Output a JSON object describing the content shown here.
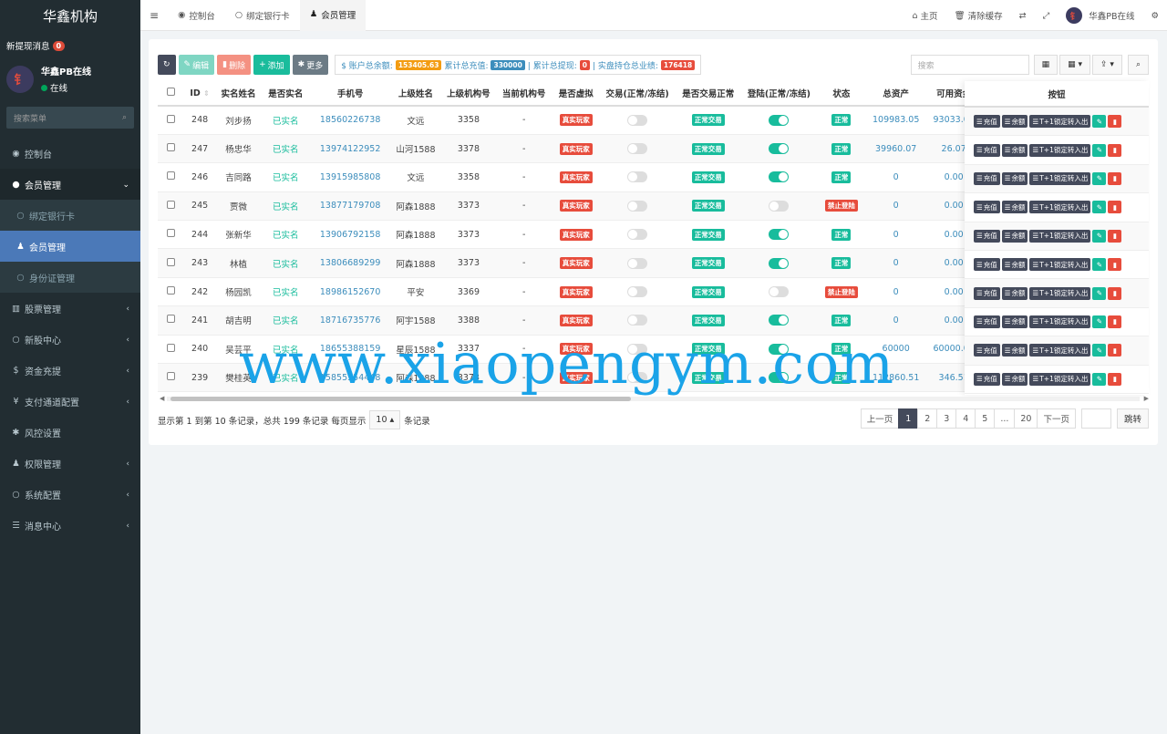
{
  "sidebar": {
    "brand": "华鑫机构",
    "notice_label": "新提现消息",
    "notice_count": "0",
    "user_avatar_char": "钅",
    "user_name": "华鑫PB在线",
    "user_status": "在线",
    "search_placeholder": "搜索菜单",
    "items": [
      {
        "icon": "dashboard-icon",
        "glyph": "◉",
        "label": "控制台"
      },
      {
        "icon": "user-circle-icon",
        "glyph": "●",
        "label": "会员管理"
      },
      {
        "icon": "circle-icon",
        "glyph": "○",
        "label": "绑定银行卡"
      },
      {
        "icon": "user-icon",
        "glyph": "♟",
        "label": "会员管理"
      },
      {
        "icon": "circle-icon",
        "glyph": "○",
        "label": "身份证管理"
      },
      {
        "icon": "bank-icon",
        "glyph": "▥",
        "label": "股票管理"
      },
      {
        "icon": "circle-icon",
        "glyph": "○",
        "label": "新股中心"
      },
      {
        "icon": "dollar-icon",
        "glyph": "$",
        "label": "资金充提"
      },
      {
        "icon": "yen-icon",
        "glyph": "¥",
        "label": "支付通道配置"
      },
      {
        "icon": "gear-icon",
        "glyph": "✱",
        "label": "风控设置"
      },
      {
        "icon": "users-icon",
        "glyph": "♟",
        "label": "权限管理"
      },
      {
        "icon": "circle-icon",
        "glyph": "○",
        "label": "系统配置"
      },
      {
        "icon": "list-icon",
        "glyph": "☰",
        "label": "消息中心"
      }
    ]
  },
  "topbar": {
    "tabs": [
      {
        "icon": "dashboard-icon",
        "glyph": "◉",
        "label": "控制台"
      },
      {
        "icon": "circle-icon",
        "glyph": "○",
        "label": "绑定银行卡"
      },
      {
        "icon": "user-icon",
        "glyph": "♟",
        "label": "会员管理"
      }
    ],
    "home_label": "主页",
    "clear_cache_label": "清除缓存",
    "user_name": "华鑫PB在线"
  },
  "toolbar": {
    "refresh": "↻",
    "edit": "编辑",
    "delete": "删除",
    "add": "添加",
    "more": "更多",
    "summary_balance_label": "$ 账户总余额:",
    "summary_balance": "153405.63",
    "summary_recharge_label": "累计总充值:",
    "summary_recharge": "330000",
    "summary_withdraw_label": "| 累计总提现:",
    "summary_withdraw": "0",
    "summary_hold_label": "| 实盘持仓总业绩:",
    "summary_hold": "176418",
    "search_placeholder": "搜索"
  },
  "table": {
    "headers": [
      "ID",
      "实名姓名",
      "是否实名",
      "手机号",
      "上级姓名",
      "上级机构号",
      "当前机构号",
      "是否虚拟",
      "交易(正常/冻结)",
      "是否交易正常",
      "登陆(正常/冻结)",
      "状态",
      "总资产",
      "可用资金"
    ],
    "action_header": "按钮",
    "rows": [
      {
        "id": "248",
        "name": "刘步扬",
        "real": "已实名",
        "phone": "18560226738",
        "parent": "文远",
        "parent_org": "3358",
        "org": "-",
        "virtual": "真实玩家",
        "trade": "off",
        "trade_ok": "正常交易",
        "login": "on",
        "status": "正常",
        "status_c": "green",
        "assets": "109983.05",
        "avail": "93033.05"
      },
      {
        "id": "247",
        "name": "杨忠华",
        "real": "已实名",
        "phone": "13974122952",
        "parent": "山河1588",
        "parent_org": "3378",
        "org": "-",
        "virtual": "真实玩家",
        "trade": "off",
        "trade_ok": "正常交易",
        "login": "on",
        "status": "正常",
        "status_c": "green",
        "assets": "39960.07",
        "avail": "26.07"
      },
      {
        "id": "246",
        "name": "吉同路",
        "real": "已实名",
        "phone": "13915985808",
        "parent": "文远",
        "parent_org": "3358",
        "org": "-",
        "virtual": "真实玩家",
        "trade": "off",
        "trade_ok": "正常交易",
        "login": "on",
        "status": "正常",
        "status_c": "green",
        "assets": "0",
        "avail": "0.00"
      },
      {
        "id": "245",
        "name": "贾微",
        "real": "已实名",
        "phone": "13877179708",
        "parent": "阿森1888",
        "parent_org": "3373",
        "org": "-",
        "virtual": "真实玩家",
        "trade": "off",
        "trade_ok": "正常交易",
        "login": "off",
        "status": "禁止登陆",
        "status_c": "red",
        "assets": "0",
        "avail": "0.00"
      },
      {
        "id": "244",
        "name": "张新华",
        "real": "已实名",
        "phone": "13906792158",
        "parent": "阿森1888",
        "parent_org": "3373",
        "org": "-",
        "virtual": "真实玩家",
        "trade": "off",
        "trade_ok": "正常交易",
        "login": "on",
        "status": "正常",
        "status_c": "green",
        "assets": "0",
        "avail": "0.00"
      },
      {
        "id": "243",
        "name": "林植",
        "real": "已实名",
        "phone": "13806689299",
        "parent": "阿森1888",
        "parent_org": "3373",
        "org": "-",
        "virtual": "真实玩家",
        "trade": "off",
        "trade_ok": "正常交易",
        "login": "on",
        "status": "正常",
        "status_c": "green",
        "assets": "0",
        "avail": "0.00"
      },
      {
        "id": "242",
        "name": "杨园凯",
        "real": "已实名",
        "phone": "18986152670",
        "parent": "平安",
        "parent_org": "3369",
        "org": "-",
        "virtual": "真实玩家",
        "trade": "off",
        "trade_ok": "正常交易",
        "login": "off",
        "status": "禁止登陆",
        "status_c": "red",
        "assets": "0",
        "avail": "0.00"
      },
      {
        "id": "241",
        "name": "胡吉明",
        "real": "已实名",
        "phone": "18716735776",
        "parent": "阿宇1588",
        "parent_org": "3388",
        "org": "-",
        "virtual": "真实玩家",
        "trade": "off",
        "trade_ok": "正常交易",
        "login": "on",
        "status": "正常",
        "status_c": "green",
        "assets": "0",
        "avail": "0.00"
      },
      {
        "id": "240",
        "name": "吴芸平",
        "real": "已实名",
        "phone": "18655388159",
        "parent": "星辰1588",
        "parent_org": "3337",
        "org": "-",
        "virtual": "真实玩家",
        "trade": "off",
        "trade_ok": "正常交易",
        "login": "on",
        "status": "正常",
        "status_c": "green",
        "assets": "60000",
        "avail": "60000.00"
      },
      {
        "id": "239",
        "name": "樊桂英",
        "real": "已实名",
        "phone": "15855554448",
        "parent": "阿森1888",
        "parent_org": "3373",
        "org": "-",
        "virtual": "真实玩家",
        "trade": "off",
        "trade_ok": "正常交易",
        "login": "on",
        "status": "正常",
        "status_c": "green",
        "assets": "112860.51",
        "avail": "346.51"
      }
    ],
    "actions": {
      "recharge": "充值",
      "balance": "余额",
      "t1": "T+1锁定转入出"
    }
  },
  "footer": {
    "info_prefix": "显示第 1 到第 10 条记录，总共 199 条记录 每页显示",
    "page_size": "10",
    "info_suffix": "条记录",
    "pages": [
      "上一页",
      "1",
      "2",
      "3",
      "4",
      "5",
      "...",
      "20",
      "下一页"
    ],
    "active_page": "1",
    "jump_label": "跳转"
  },
  "watermark": "www.xiaopengym.com",
  "colors": {
    "sidebar_bg": "#222d32",
    "active_menu": "#4b79b8",
    "green": "#18bc9c",
    "red": "#e74c3c",
    "dark_btn": "#444a5b"
  }
}
